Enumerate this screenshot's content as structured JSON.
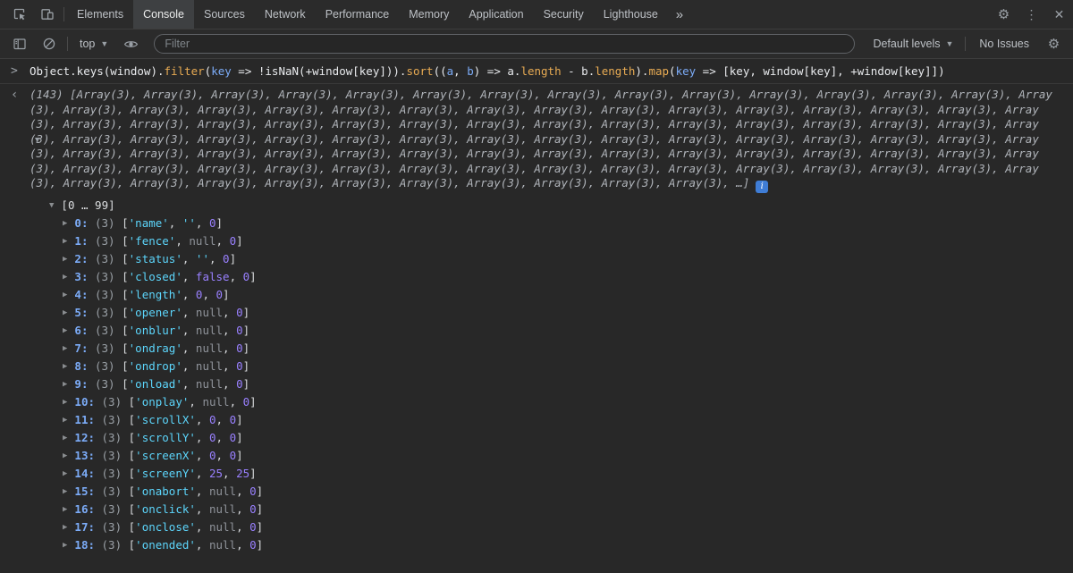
{
  "tabbar": {
    "tabs": [
      "Elements",
      "Console",
      "Sources",
      "Network",
      "Performance",
      "Memory",
      "Application",
      "Security",
      "Lighthouse"
    ],
    "active_tab": "Console"
  },
  "icons": {
    "more_tabs": "»",
    "gear": "⚙",
    "kebab": "⋮",
    "close": "✕",
    "dropdown": "▼",
    "prompt": ">",
    "returned": "‹",
    "expander_open": "▼",
    "expander_closed": "▶"
  },
  "toolbar": {
    "context": "top",
    "filter_placeholder": "Filter",
    "levels": "Default levels",
    "issues": "No Issues"
  },
  "command": {
    "segments": [
      {
        "t": "plain",
        "v": "Object.keys(window)."
      },
      {
        "t": "prop",
        "v": "filter"
      },
      {
        "t": "plain",
        "v": "("
      },
      {
        "t": "param",
        "v": "key"
      },
      {
        "t": "plain",
        "v": " => !isNaN(+window[key]))."
      },
      {
        "t": "prop",
        "v": "sort"
      },
      {
        "t": "plain",
        "v": "(("
      },
      {
        "t": "param",
        "v": "a"
      },
      {
        "t": "plain",
        "v": ", "
      },
      {
        "t": "param",
        "v": "b"
      },
      {
        "t": "plain",
        "v": ") => a."
      },
      {
        "t": "prop",
        "v": "length"
      },
      {
        "t": "plain",
        "v": " - b."
      },
      {
        "t": "prop",
        "v": "length"
      },
      {
        "t": "plain",
        "v": ")."
      },
      {
        "t": "prop",
        "v": "map"
      },
      {
        "t": "plain",
        "v": "("
      },
      {
        "t": "param",
        "v": "key"
      },
      {
        "t": "plain",
        "v": " => [key, window[key], +window[key]])"
      }
    ]
  },
  "result": {
    "count": "(143)",
    "bracket_open": "[",
    "preview_item": "Array(3)",
    "preview_separator": ", ",
    "preview_visible_items": 100,
    "preview_tail": "…]",
    "info_icon_label": "i",
    "range": "[0 … 99]",
    "rows": [
      {
        "index": "0",
        "size": "(3)",
        "values": [
          {
            "type": "string",
            "text": "'name'"
          },
          {
            "type": "string",
            "text": "''"
          },
          {
            "type": "number",
            "text": "0"
          }
        ]
      },
      {
        "index": "1",
        "size": "(3)",
        "values": [
          {
            "type": "string",
            "text": "'fence'"
          },
          {
            "type": "null",
            "text": "null"
          },
          {
            "type": "number",
            "text": "0"
          }
        ]
      },
      {
        "index": "2",
        "size": "(3)",
        "values": [
          {
            "type": "string",
            "text": "'status'"
          },
          {
            "type": "string",
            "text": "''"
          },
          {
            "type": "number",
            "text": "0"
          }
        ]
      },
      {
        "index": "3",
        "size": "(3)",
        "values": [
          {
            "type": "string",
            "text": "'closed'"
          },
          {
            "type": "boolean",
            "text": "false"
          },
          {
            "type": "number",
            "text": "0"
          }
        ]
      },
      {
        "index": "4",
        "size": "(3)",
        "values": [
          {
            "type": "string",
            "text": "'length'"
          },
          {
            "type": "number",
            "text": "0"
          },
          {
            "type": "number",
            "text": "0"
          }
        ]
      },
      {
        "index": "5",
        "size": "(3)",
        "values": [
          {
            "type": "string",
            "text": "'opener'"
          },
          {
            "type": "null",
            "text": "null"
          },
          {
            "type": "number",
            "text": "0"
          }
        ]
      },
      {
        "index": "6",
        "size": "(3)",
        "values": [
          {
            "type": "string",
            "text": "'onblur'"
          },
          {
            "type": "null",
            "text": "null"
          },
          {
            "type": "number",
            "text": "0"
          }
        ]
      },
      {
        "index": "7",
        "size": "(3)",
        "values": [
          {
            "type": "string",
            "text": "'ondrag'"
          },
          {
            "type": "null",
            "text": "null"
          },
          {
            "type": "number",
            "text": "0"
          }
        ]
      },
      {
        "index": "8",
        "size": "(3)",
        "values": [
          {
            "type": "string",
            "text": "'ondrop'"
          },
          {
            "type": "null",
            "text": "null"
          },
          {
            "type": "number",
            "text": "0"
          }
        ]
      },
      {
        "index": "9",
        "size": "(3)",
        "values": [
          {
            "type": "string",
            "text": "'onload'"
          },
          {
            "type": "null",
            "text": "null"
          },
          {
            "type": "number",
            "text": "0"
          }
        ]
      },
      {
        "index": "10",
        "size": "(3)",
        "values": [
          {
            "type": "string",
            "text": "'onplay'"
          },
          {
            "type": "null",
            "text": "null"
          },
          {
            "type": "number",
            "text": "0"
          }
        ]
      },
      {
        "index": "11",
        "size": "(3)",
        "values": [
          {
            "type": "string",
            "text": "'scrollX'"
          },
          {
            "type": "number",
            "text": "0"
          },
          {
            "type": "number",
            "text": "0"
          }
        ]
      },
      {
        "index": "12",
        "size": "(3)",
        "values": [
          {
            "type": "string",
            "text": "'scrollY'"
          },
          {
            "type": "number",
            "text": "0"
          },
          {
            "type": "number",
            "text": "0"
          }
        ]
      },
      {
        "index": "13",
        "size": "(3)",
        "values": [
          {
            "type": "string",
            "text": "'screenX'"
          },
          {
            "type": "number",
            "text": "0"
          },
          {
            "type": "number",
            "text": "0"
          }
        ]
      },
      {
        "index": "14",
        "size": "(3)",
        "values": [
          {
            "type": "string",
            "text": "'screenY'"
          },
          {
            "type": "number",
            "text": "25"
          },
          {
            "type": "number",
            "text": "25"
          }
        ]
      },
      {
        "index": "15",
        "size": "(3)",
        "values": [
          {
            "type": "string",
            "text": "'onabort'"
          },
          {
            "type": "null",
            "text": "null"
          },
          {
            "type": "number",
            "text": "0"
          }
        ]
      },
      {
        "index": "16",
        "size": "(3)",
        "values": [
          {
            "type": "string",
            "text": "'onclick'"
          },
          {
            "type": "null",
            "text": "null"
          },
          {
            "type": "number",
            "text": "0"
          }
        ]
      },
      {
        "index": "17",
        "size": "(3)",
        "values": [
          {
            "type": "string",
            "text": "'onclose'"
          },
          {
            "type": "null",
            "text": "null"
          },
          {
            "type": "number",
            "text": "0"
          }
        ]
      },
      {
        "index": "18",
        "size": "(3)",
        "values": [
          {
            "type": "string",
            "text": "'onended'"
          },
          {
            "type": "null",
            "text": "null"
          },
          {
            "type": "number",
            "text": "0"
          }
        ]
      }
    ]
  },
  "colors": {
    "property": "#e8ab53",
    "param": "#7cacf8",
    "plain_code": "#e8eaed",
    "string": "#5cd5fb",
    "number": "#9980ff",
    "boolean": "#9980ff",
    "null_value": "#8f939a",
    "index": "#7cacf8",
    "preview_text": "#b0b4ba",
    "info_icon_bg": "#3f7dd6",
    "active_tab_bg": "#3e4042"
  }
}
